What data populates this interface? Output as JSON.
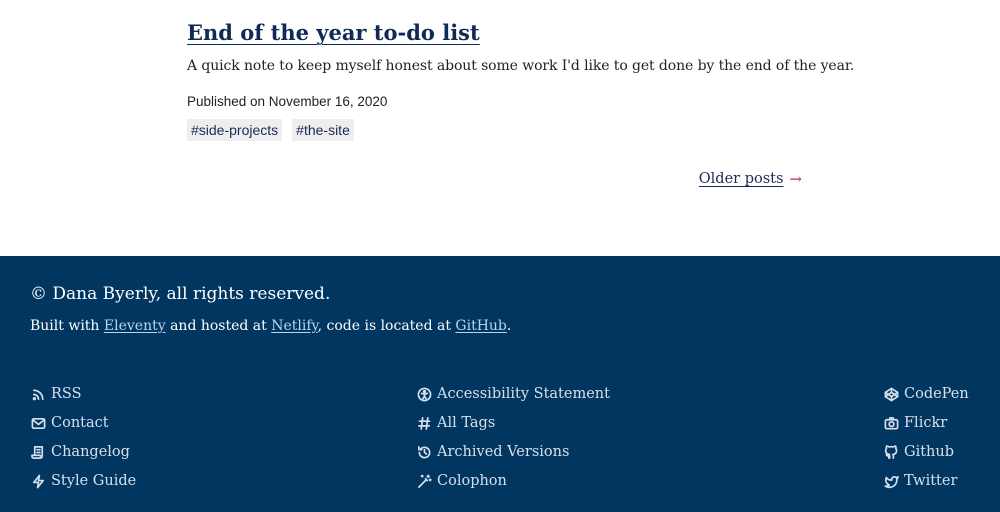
{
  "post": {
    "title": "End of the year to-do list",
    "description": "A quick note to keep myself honest about some work I'd like to get done by the end of the year.",
    "published": "Published on November 16, 2020",
    "tags": [
      "#side-projects",
      "#the-site"
    ]
  },
  "pagination": {
    "older_label": "Older posts",
    "arrow": "→"
  },
  "footer": {
    "copyright": "© Dana Byerly, all rights reserved.",
    "built_prefix": "Built with ",
    "built_eleventy": "Eleventy",
    "built_middle": " and hosted at ",
    "built_netlify": "Netlify",
    "built_middle2": ", code is located at ",
    "built_github": "GitHub",
    "built_suffix": ".",
    "links_left": [
      {
        "label": "RSS",
        "icon": "rss-icon"
      },
      {
        "label": "Contact",
        "icon": "mail-icon"
      },
      {
        "label": "Changelog",
        "icon": "scroll-icon"
      },
      {
        "label": "Style Guide",
        "icon": "bolt-icon"
      }
    ],
    "links_mid": [
      {
        "label": "Accessibility Statement",
        "icon": "accessibility-icon"
      },
      {
        "label": "All Tags",
        "icon": "hash-icon"
      },
      {
        "label": "Archived Versions",
        "icon": "history-icon"
      },
      {
        "label": "Colophon",
        "icon": "wand-icon"
      }
    ],
    "links_right": [
      {
        "label": "CodePen",
        "icon": "codepen-icon"
      },
      {
        "label": "Flickr",
        "icon": "camera-icon"
      },
      {
        "label": "Github",
        "icon": "github-icon"
      },
      {
        "label": "Twitter",
        "icon": "twitter-icon"
      }
    ]
  },
  "colors": {
    "footer_bg": "#003660",
    "title": "#0f2a55",
    "arrow_accent": "#c0227a",
    "footer_link": "#b9d3f0"
  }
}
